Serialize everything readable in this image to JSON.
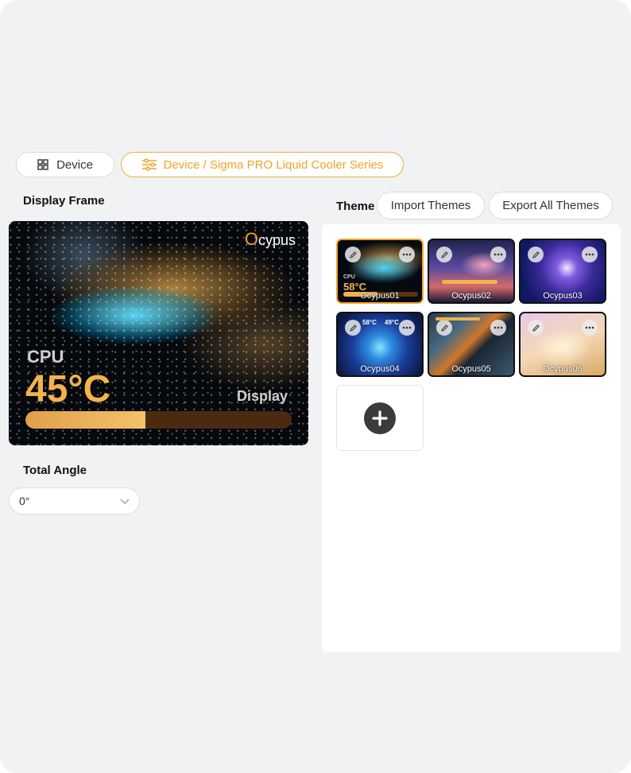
{
  "nav": {
    "device_label": "Device",
    "breadcrumb_label": "Device / Sigma PRO Liquid Cooler Series"
  },
  "display_frame": {
    "title": "Display Frame",
    "brand": "cypus",
    "brand_initial": "O",
    "cpu_label": "CPU",
    "cpu_temp": "45°C",
    "display_label": "Display",
    "bar_fill_fraction": 0.45
  },
  "angle": {
    "title": "Total Angle",
    "value": "0°"
  },
  "theme": {
    "title": "Theme",
    "import_label": "Import Themes",
    "export_label": "Export All Themes",
    "items": [
      {
        "name": "Ocypus01",
        "selected": true
      },
      {
        "name": "Ocypus02",
        "selected": false
      },
      {
        "name": "Ocypus03",
        "selected": false
      },
      {
        "name": "Ocypus04",
        "selected": false
      },
      {
        "name": "Ocypus05",
        "selected": false
      },
      {
        "name": "Ocypus06",
        "selected": false
      }
    ]
  },
  "colors": {
    "accent": "#f0a52a",
    "temp": "#f2b24e",
    "background": "#f1f2f4"
  }
}
